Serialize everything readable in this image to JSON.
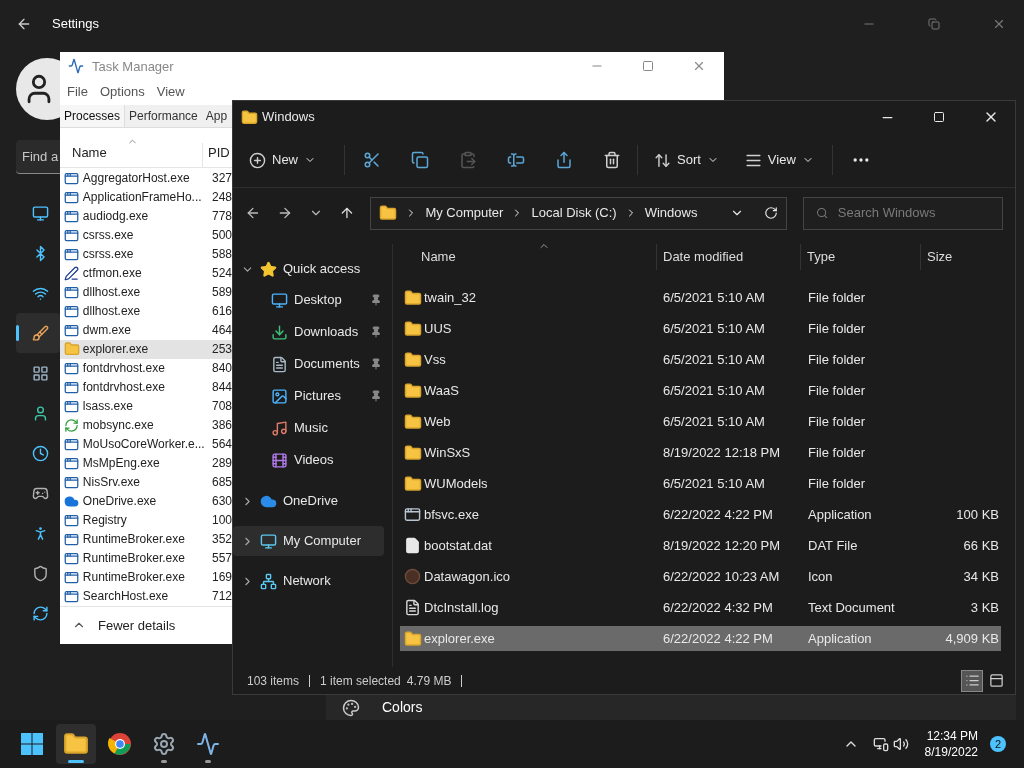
{
  "settings": {
    "title": "Settings",
    "search": {
      "placeholder": "Find a"
    },
    "nav_items": [
      {
        "selected": false
      },
      {
        "selected": false
      },
      {
        "selected": false
      },
      {
        "selected": true
      },
      {
        "selected": false
      },
      {
        "selected": false
      },
      {
        "selected": false
      },
      {
        "selected": false
      },
      {
        "selected": false
      },
      {
        "selected": false
      },
      {
        "selected": false
      }
    ],
    "row_label": "Colors"
  },
  "task_manager": {
    "title": "Task Manager",
    "menu": [
      "File",
      "Options",
      "View"
    ],
    "tabs": [
      {
        "label": "Processes",
        "selected": true
      },
      {
        "label": "Performance",
        "selected": false
      },
      {
        "label": "App",
        "selected": false
      }
    ],
    "columns": [
      "Name",
      "PID"
    ],
    "rows": [
      {
        "name": "AggregatorHost.exe",
        "pid": "327",
        "kind": "app",
        "selected": false
      },
      {
        "name": "ApplicationFrameHo...",
        "pid": "248",
        "kind": "app",
        "selected": false
      },
      {
        "name": "audiodg.exe",
        "pid": "778",
        "kind": "app",
        "selected": false
      },
      {
        "name": "csrss.exe",
        "pid": "500",
        "kind": "app",
        "selected": false
      },
      {
        "name": "csrss.exe",
        "pid": "588",
        "kind": "app",
        "selected": false
      },
      {
        "name": "ctfmon.exe",
        "pid": "524",
        "kind": "edit",
        "selected": false
      },
      {
        "name": "dllhost.exe",
        "pid": "589",
        "kind": "app",
        "selected": false
      },
      {
        "name": "dllhost.exe",
        "pid": "616",
        "kind": "app",
        "selected": false
      },
      {
        "name": "dwm.exe",
        "pid": "464",
        "kind": "app",
        "selected": false
      },
      {
        "name": "explorer.exe",
        "pid": "253",
        "kind": "folder",
        "selected": true
      },
      {
        "name": "fontdrvhost.exe",
        "pid": "840",
        "kind": "app",
        "selected": false
      },
      {
        "name": "fontdrvhost.exe",
        "pid": "844",
        "kind": "app",
        "selected": false
      },
      {
        "name": "lsass.exe",
        "pid": "708",
        "kind": "app",
        "selected": false
      },
      {
        "name": "mobsync.exe",
        "pid": "386",
        "kind": "sync",
        "selected": false
      },
      {
        "name": "MoUsoCoreWorker.e...",
        "pid": "564",
        "kind": "app",
        "selected": false
      },
      {
        "name": "MsMpEng.exe",
        "pid": "289",
        "kind": "app",
        "selected": false
      },
      {
        "name": "NisSrv.exe",
        "pid": "685",
        "kind": "app",
        "selected": false
      },
      {
        "name": "OneDrive.exe",
        "pid": "630",
        "kind": "cloud",
        "selected": false
      },
      {
        "name": "Registry",
        "pid": "100",
        "kind": "app",
        "selected": false
      },
      {
        "name": "RuntimeBroker.exe",
        "pid": "352",
        "kind": "app",
        "selected": false
      },
      {
        "name": "RuntimeBroker.exe",
        "pid": "557",
        "kind": "app",
        "selected": false
      },
      {
        "name": "RuntimeBroker.exe",
        "pid": "169",
        "kind": "app",
        "selected": false
      },
      {
        "name": "SearchHost.exe",
        "pid": "712",
        "kind": "app",
        "selected": false
      }
    ],
    "footer": "Fewer details"
  },
  "explorer": {
    "title": "Windows",
    "toolbar": {
      "new": "New",
      "sort": "Sort",
      "view": "View"
    },
    "breadcrumb": [
      "My Computer",
      "Local Disk (C:)",
      "Windows"
    ],
    "search": {
      "placeholder": "Search Windows"
    },
    "nav": [
      {
        "label": "Quick access",
        "kind": "star",
        "expanded": true,
        "selected": false,
        "children": [
          {
            "label": "Desktop",
            "kind": "desktop",
            "pinned": true
          },
          {
            "label": "Downloads",
            "kind": "download",
            "pinned": true
          },
          {
            "label": "Documents",
            "kind": "document",
            "pinned": true
          },
          {
            "label": "Pictures",
            "kind": "picture",
            "pinned": true
          },
          {
            "label": "Music",
            "kind": "music",
            "pinned": false
          },
          {
            "label": "Videos",
            "kind": "video",
            "pinned": false
          }
        ]
      },
      {
        "label": "OneDrive",
        "kind": "cloud",
        "expanded": false,
        "selected": false
      },
      {
        "label": "My Computer",
        "kind": "computer",
        "expanded": false,
        "selected": true
      },
      {
        "label": "Network",
        "kind": "network",
        "expanded": false,
        "selected": false
      }
    ],
    "columns": [
      "Name",
      "Date modified",
      "Type",
      "Size"
    ],
    "rows": [
      {
        "name": "twain_32",
        "date": "6/5/2021 5:10 AM",
        "type": "File folder",
        "kind": "folder",
        "selected": false
      },
      {
        "name": "UUS",
        "date": "6/5/2021 5:10 AM",
        "type": "File folder",
        "kind": "folder",
        "selected": false
      },
      {
        "name": "Vss",
        "date": "6/5/2021 5:10 AM",
        "type": "File folder",
        "kind": "folder",
        "selected": false
      },
      {
        "name": "WaaS",
        "date": "6/5/2021 5:10 AM",
        "type": "File folder",
        "kind": "folder",
        "selected": false
      },
      {
        "name": "Web",
        "date": "6/5/2021 5:10 AM",
        "type": "File folder",
        "kind": "folder",
        "selected": false
      },
      {
        "name": "WinSxS",
        "date": "8/19/2022 12:18 PM",
        "type": "File folder",
        "kind": "folder",
        "selected": false
      },
      {
        "name": "WUModels",
        "date": "6/5/2021 5:10 AM",
        "type": "File folder",
        "kind": "folder",
        "selected": false
      },
      {
        "name": "bfsvc.exe",
        "date": "6/22/2022 4:22 PM",
        "type": "Application",
        "size": "100 KB",
        "kind": "app",
        "selected": false
      },
      {
        "name": "bootstat.dat",
        "date": "8/19/2022 12:20 PM",
        "type": "DAT File",
        "size": "66 KB",
        "kind": "file",
        "selected": false
      },
      {
        "name": "Datawagon.ico",
        "date": "6/22/2022 10:23 AM",
        "type": "Icon",
        "size": "34 KB",
        "kind": "icon",
        "selected": false
      },
      {
        "name": "DtcInstall.log",
        "date": "6/22/2022 4:32 PM",
        "type": "Text Document",
        "size": "3 KB",
        "kind": "text",
        "selected": false
      },
      {
        "name": "explorer.exe",
        "date": "6/22/2022 4:22 PM",
        "type": "Application",
        "size": "4,909 KB",
        "kind": "explorer",
        "selected": true
      }
    ],
    "status": {
      "count": "103 items",
      "selection": "1 item selected",
      "size": "4.79 MB"
    },
    "views": [
      {
        "kind": "details",
        "selected": true
      },
      {
        "kind": "tiles",
        "selected": false
      }
    ]
  },
  "taskbar": {
    "apps": [
      {
        "kind": "explorer",
        "active": true,
        "running": true
      },
      {
        "kind": "chrome",
        "active": false,
        "running": false
      },
      {
        "kind": "settings",
        "active": false,
        "running": true
      },
      {
        "kind": "taskmgr",
        "active": false,
        "running": true
      }
    ],
    "time": "12:34 PM",
    "date": "8/19/2022",
    "badge": "2"
  }
}
